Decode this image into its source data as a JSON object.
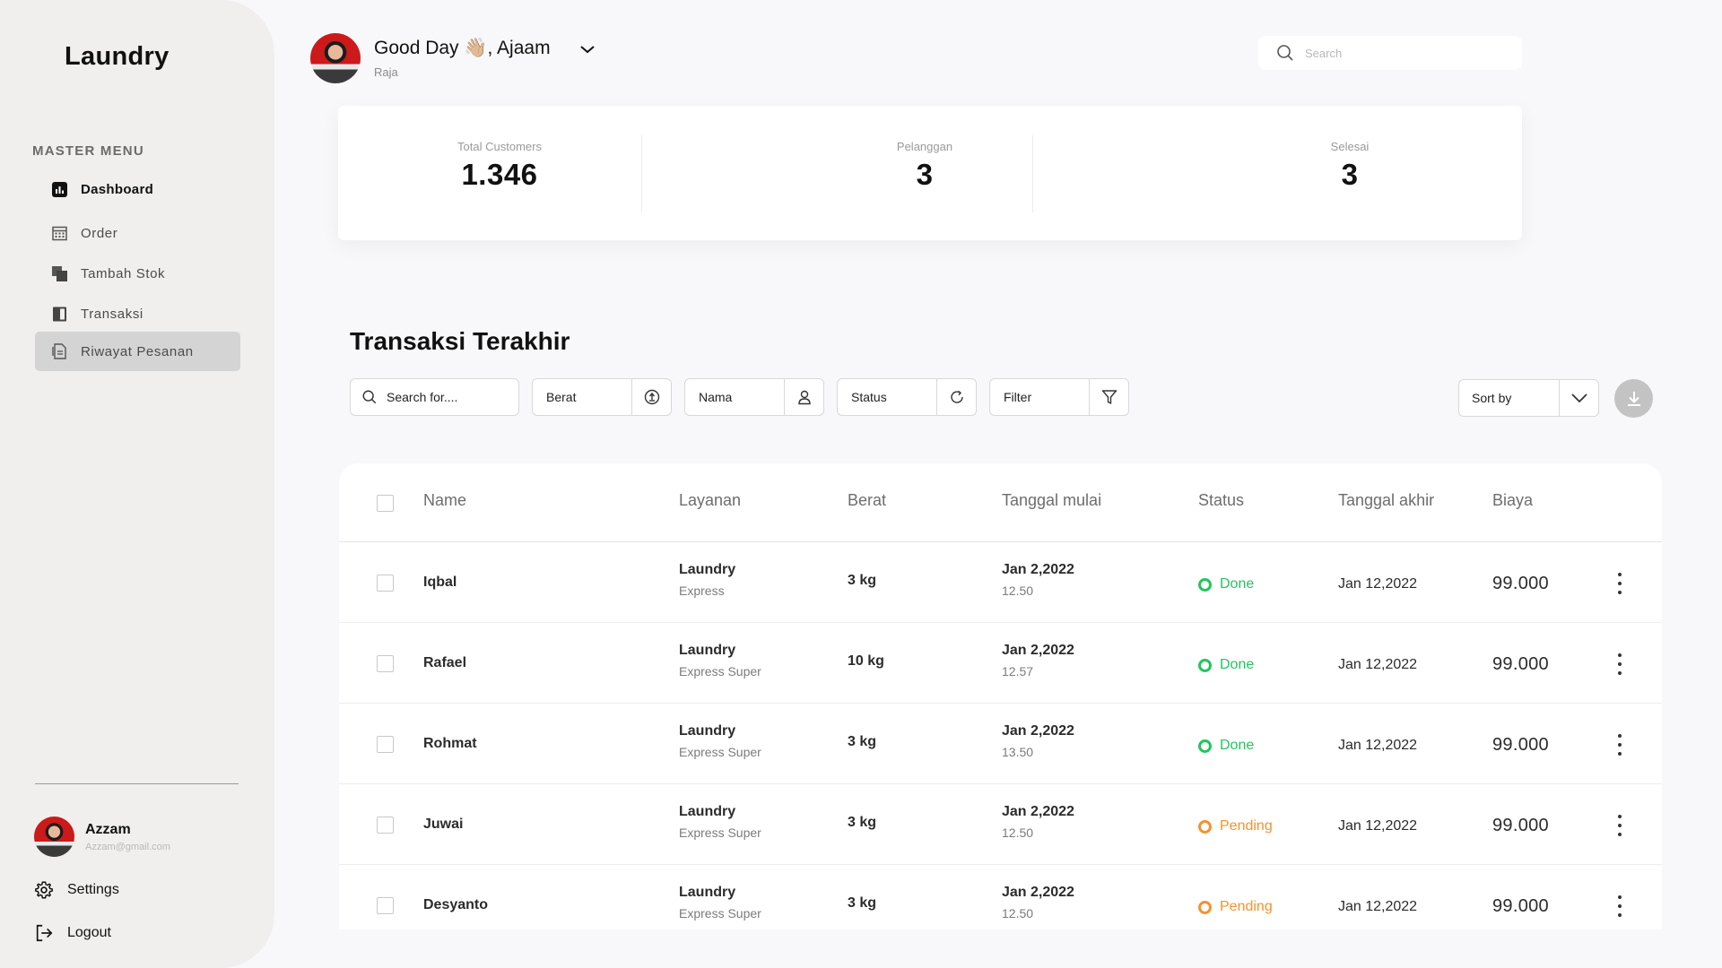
{
  "colors": {
    "done": "#22c55e",
    "pending": "#f5912f"
  },
  "sidebar": {
    "brand": "Laundry",
    "menu_title": "MASTER MENU",
    "items": [
      {
        "label": "Dashboard",
        "icon": "dashboard-icon"
      },
      {
        "label": "Order",
        "icon": "calendar-icon"
      },
      {
        "label": "Tambah Stok",
        "icon": "stack-icon"
      },
      {
        "label": "Transaksi",
        "icon": "book-icon"
      },
      {
        "label": "Riwayat Pesanan",
        "icon": "file-icon"
      }
    ],
    "profile": {
      "name": "Azzam",
      "email": "Azzam@gmail.com"
    },
    "settings_label": "Settings",
    "logout_label": "Logout"
  },
  "header": {
    "greeting": "Good Day 👋🏼, Ajaam",
    "role": "Raja",
    "search_placeholder": "Search"
  },
  "stats": [
    {
      "label": "Total Customers",
      "value": "1.346"
    },
    {
      "label": "Pelanggan",
      "value": "3"
    },
    {
      "label": "Selesai",
      "value": "3"
    }
  ],
  "transactions": {
    "title": "Transaksi Terakhir",
    "search_placeholder": "Search for....",
    "filters": {
      "berat": "Berat",
      "nama": "Nama",
      "status": "Status",
      "filter": "Filter"
    },
    "sort_label": "Sort by",
    "columns": [
      "Name",
      "Layanan",
      "Berat",
      "Tanggal mulai",
      "Status",
      "Tanggal akhir",
      "Biaya"
    ],
    "rows": [
      {
        "name": "Iqbal",
        "service": "Laundry",
        "service_type": "Express",
        "weight": "3 kg",
        "start_date": "Jan 2,2022",
        "start_time": "12.50",
        "status": "Done",
        "end_date": "Jan 12,2022",
        "cost": "99.000"
      },
      {
        "name": "Rafael",
        "service": "Laundry",
        "service_type": "Express Super",
        "weight": "10 kg",
        "start_date": "Jan 2,2022",
        "start_time": "12.57",
        "status": "Done",
        "end_date": "Jan 12,2022",
        "cost": "99.000"
      },
      {
        "name": "Rohmat",
        "service": "Laundry",
        "service_type": "Express Super",
        "weight": "3 kg",
        "start_date": "Jan 2,2022",
        "start_time": "13.50",
        "status": "Done",
        "end_date": "Jan 12,2022",
        "cost": "99.000"
      },
      {
        "name": "Juwai",
        "service": "Laundry",
        "service_type": "Express Super",
        "weight": "3 kg",
        "start_date": "Jan 2,2022",
        "start_time": "12.50",
        "status": "Pending",
        "end_date": "Jan 12,2022",
        "cost": "99.000"
      },
      {
        "name": "Desyanto",
        "service": "Laundry",
        "service_type": "Express Super",
        "weight": "3 kg",
        "start_date": "Jan 2,2022",
        "start_time": "12.50",
        "status": "Pending",
        "end_date": "Jan 12,2022",
        "cost": "99.000"
      }
    ]
  }
}
